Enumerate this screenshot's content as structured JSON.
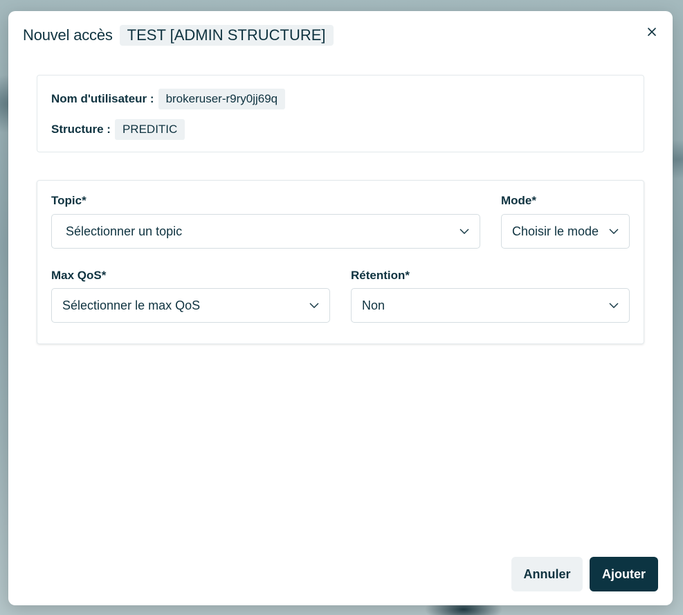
{
  "modal": {
    "title": "Nouvel accès",
    "badge": "TEST [ADMIN STRUCTURE]",
    "close_icon": "close-icon"
  },
  "info": {
    "username_label": "Nom d'utilisateur :",
    "username_value": "brokeruser-r9ry0jj69q",
    "structure_label": "Structure :",
    "structure_value": "PREDITIC"
  },
  "form": {
    "topic": {
      "label": "Topic*",
      "value": "Sélectionner un topic"
    },
    "mode": {
      "label": "Mode*",
      "value": "Choisir le mode"
    },
    "max_qos": {
      "label": "Max QoS*",
      "value": "Sélectionner le max QoS"
    },
    "retention": {
      "label": "Rétention*",
      "value": "Non"
    }
  },
  "actions": {
    "cancel_label": "Annuler",
    "add_label": "Ajouter"
  },
  "colors": {
    "primary": "#0c3442",
    "badge_bg": "#edf1f3",
    "text": "#0f3340"
  }
}
